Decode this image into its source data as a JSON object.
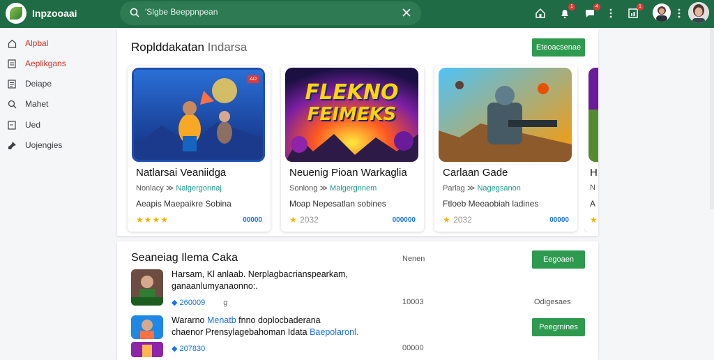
{
  "app": {
    "title": "Inpzooaai"
  },
  "search": {
    "placeholder": "'Slgbe Beeppnpean"
  },
  "header": {
    "badges": [
      "1",
      "4",
      "1"
    ]
  },
  "sidebar": {
    "items": [
      {
        "label": "Alpbal",
        "icon": "home-icon",
        "active": true
      },
      {
        "label": "Aeplikgans",
        "icon": "document-icon",
        "active": true
      },
      {
        "label": "Deiape",
        "icon": "list-icon",
        "active": false
      },
      {
        "label": "Mahet",
        "icon": "search-icon",
        "active": false
      },
      {
        "label": "Ued",
        "icon": "page-icon",
        "active": false
      },
      {
        "label": "Uojengies",
        "icon": "pin-icon",
        "active": false
      }
    ]
  },
  "featured": {
    "title": "Roplddakatan",
    "title_light": "Indarsa",
    "button_label": "Eteoacsenae",
    "cards": [
      {
        "title": "Natlarsai Veaniidga",
        "meta": "Nonlacy",
        "meta_sep": "≫",
        "tag": "Nalgergonnaj",
        "desc": "Aeapis Maepaikre Sobina",
        "stars": "★★★★",
        "rating": "",
        "count": "00000",
        "badge": "AD"
      },
      {
        "title": "Neuenig Pioan Warkaglia",
        "meta": "Sonlong",
        "meta_sep": "≫",
        "tag": "Malgergnnem",
        "desc": "Moap Nepesatlan sobines",
        "stars": "★",
        "rating": "2032",
        "count": "000000",
        "logo_line1": "FLEKNO",
        "logo_line2": "FEIMEKS"
      },
      {
        "title": "Carlaan Gade",
        "meta": "Parlag",
        "meta_sep": "≫",
        "tag": "Nagegsanon",
        "desc": "Ftloeb Meeaobiah ladines",
        "stars": "★",
        "rating": "2032",
        "count": "00000"
      },
      {
        "title": "H",
        "meta": "N",
        "desc": "A",
        "stars": "★"
      }
    ]
  },
  "searching": {
    "title": "Seaneiag Ilema Caka",
    "header_label": "Nenen",
    "button_label": "Eegoaen",
    "rows": [
      {
        "title": "Harsam, Kl",
        "title_rest": "anlaab. Nerplagbacrianspearkam,",
        "line2": "ganaanlumyanaonno:.",
        "sub_count": "260009",
        "sub_tail": "g",
        "num": "10003",
        "side": "Odigesaes",
        "button": ""
      },
      {
        "title": "Wararno",
        "title_blue": "Menatb",
        "title_rest": "fnno doplocbaderana",
        "line2": "chaenor Prensylagebahoman Idata",
        "line2_blue": "Baepolaronl.",
        "sub_count": "207830",
        "sub_tail": "",
        "num": "00000",
        "side": "",
        "button": "Peegrnines"
      }
    ]
  }
}
